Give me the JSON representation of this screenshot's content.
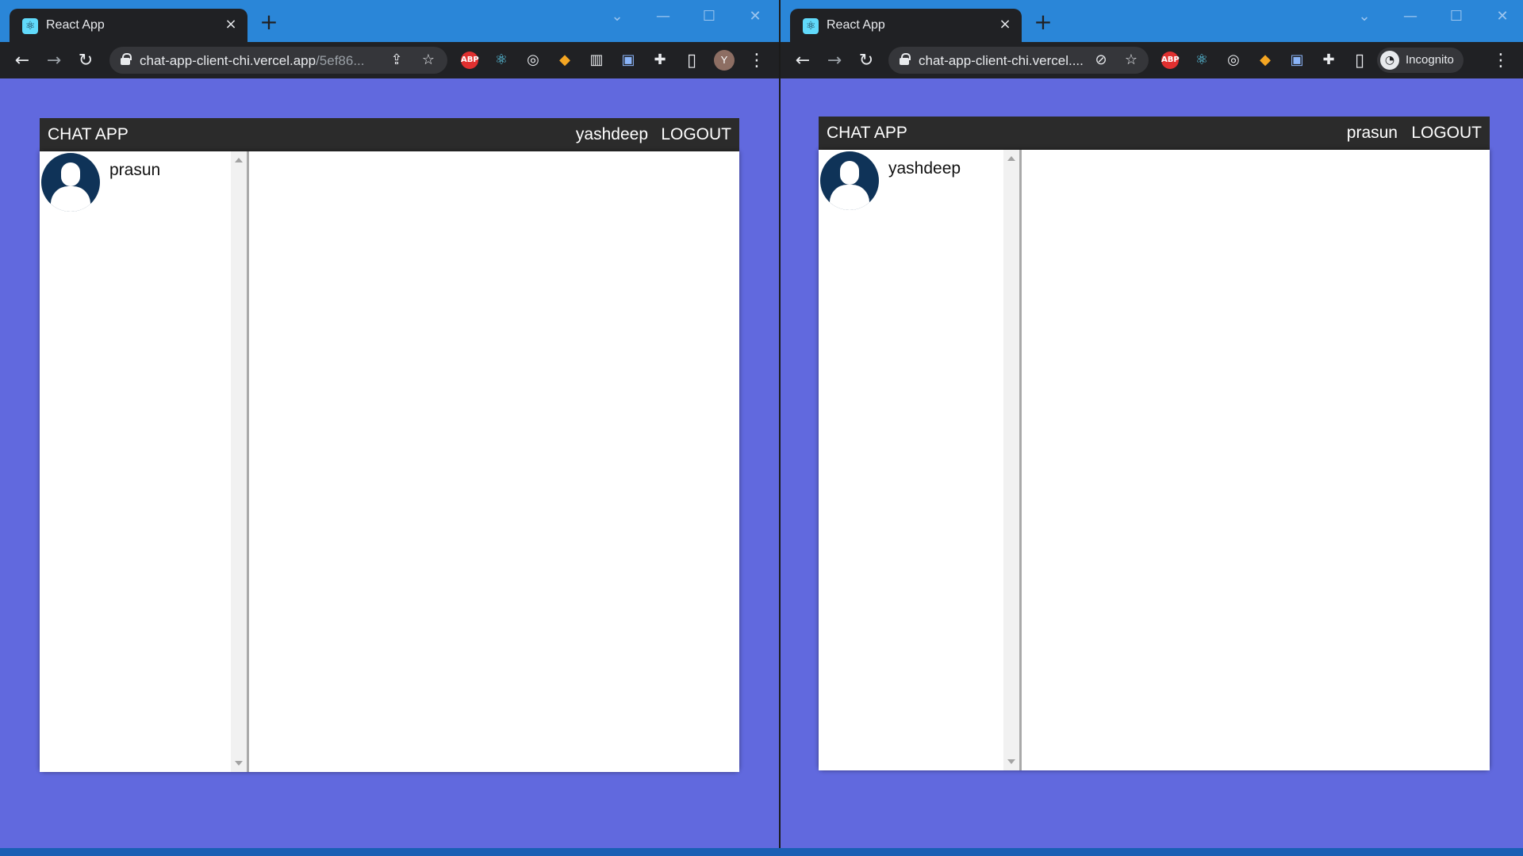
{
  "left_window": {
    "tab_title": "React App",
    "url_main": "chat-app-client-chi.vercel.app",
    "url_rest": "/5ef86...",
    "profile_initial": "Y",
    "extensions": [
      "ABP",
      "⚛",
      "◎",
      "◆",
      "▥",
      "▣",
      "✚"
    ],
    "app": {
      "brand": "CHAT APP",
      "current_user": "yashdeep",
      "logout": "LOGOUT",
      "contacts": [
        {
          "name": "prasun"
        }
      ]
    }
  },
  "right_window": {
    "tab_title": "React App",
    "url_main": "chat-app-client-chi.vercel....",
    "incognito_label": "Incognito",
    "extensions": [
      "ABP",
      "⚛",
      "◎",
      "◆",
      "▣",
      "✚"
    ],
    "app": {
      "brand": "CHAT APP",
      "current_user": "prasun",
      "logout": "LOGOUT",
      "contacts": [
        {
          "name": "yashdeep"
        }
      ]
    }
  },
  "colors": {
    "page_background": "#6169de",
    "chrome_frame": "#2a86d8",
    "toolbar": "#202124",
    "appbar": "#2b2b2b",
    "avatar": "#0f3358"
  },
  "icons": {
    "tab_close": "×",
    "new_tab": "+",
    "back": "←",
    "forward": "→",
    "reload": "↻",
    "share": "⇪",
    "star": "☆",
    "eye_off": "⊘",
    "side_panel": "▯",
    "menu": "⋮",
    "minimize": "—",
    "maximize": "☐",
    "close": "✕",
    "chevron": "⌄"
  }
}
